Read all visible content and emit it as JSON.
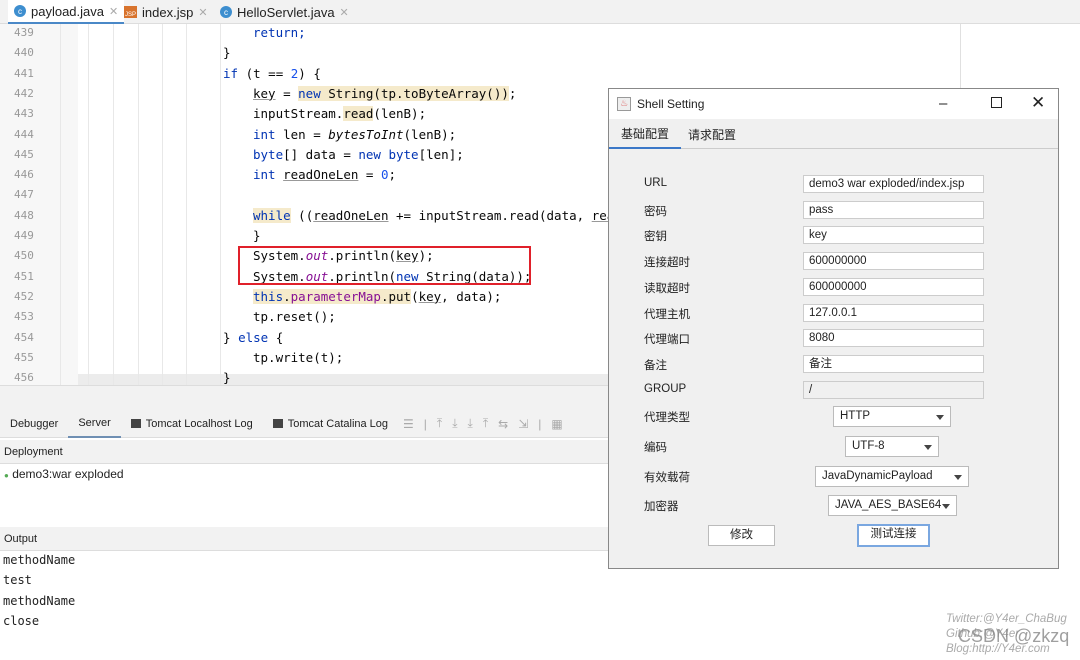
{
  "file_tabs": [
    {
      "label": "payload.java",
      "icon": "java-class-icon",
      "active": true
    },
    {
      "label": "index.jsp",
      "icon": "jsp-file-icon",
      "active": false
    },
    {
      "label": "HelloServlet.java",
      "icon": "java-class-icon",
      "active": false
    }
  ],
  "editor": {
    "line_numbers": [
      "439",
      "440",
      "441",
      "442",
      "443",
      "444",
      "445",
      "446",
      "447",
      "448",
      "449",
      "450",
      "451",
      "452",
      "453",
      "454",
      "455",
      "456"
    ],
    "lines": [
      {
        "indent": 2,
        "tokens": [
          [
            "return;",
            "kw"
          ]
        ]
      },
      {
        "indent": 1,
        "tokens": [
          [
            "}",
            ""
          ]
        ]
      },
      {
        "indent": 1,
        "tokens": [
          [
            "if",
            "kw"
          ],
          [
            " (t == ",
            ""
          ],
          [
            "2",
            "num"
          ],
          [
            ") {",
            ""
          ]
        ]
      },
      {
        "indent": 2,
        "tokens": [
          [
            "key",
            "ul"
          ],
          [
            " = ",
            ""
          ],
          [
            "new",
            "kw hl"
          ],
          [
            " String(tp.toByteArray())",
            "hl"
          ],
          [
            ";",
            ""
          ]
        ]
      },
      {
        "indent": 2,
        "tokens": [
          [
            "inputStream.",
            ""
          ],
          [
            "read",
            "hl"
          ],
          [
            "(lenB);",
            ""
          ]
        ]
      },
      {
        "indent": 2,
        "tokens": [
          [
            "int",
            "kw"
          ],
          [
            " len = ",
            ""
          ],
          [
            "bytesToInt",
            "it"
          ],
          [
            "(lenB);",
            ""
          ]
        ]
      },
      {
        "indent": 2,
        "tokens": [
          [
            "byte",
            "kw"
          ],
          [
            "[] data = ",
            ""
          ],
          [
            "new",
            "kw"
          ],
          [
            " ",
            ""
          ],
          [
            "byte",
            "kw"
          ],
          [
            "[len];",
            ""
          ]
        ]
      },
      {
        "indent": 2,
        "tokens": [
          [
            "int",
            "kw"
          ],
          [
            " ",
            ""
          ],
          [
            "readOneLen",
            "ul"
          ],
          [
            " = ",
            ""
          ],
          [
            "0",
            "num"
          ],
          [
            ";",
            ""
          ]
        ]
      },
      {
        "indent": 2,
        "tokens": []
      },
      {
        "indent": 2,
        "tokens": [
          [
            "while",
            "kw hl"
          ],
          [
            " ((",
            ""
          ],
          [
            "readOneLen",
            "ul"
          ],
          [
            " += inputStream.read(data, ",
            ""
          ],
          [
            "rea",
            "ul"
          ]
        ]
      },
      {
        "indent": 2,
        "tokens": [
          [
            "}",
            ""
          ]
        ]
      },
      {
        "indent": 2,
        "tokens": [
          [
            "System.",
            ""
          ],
          [
            "out",
            "fld"
          ],
          [
            ".println(",
            ""
          ],
          [
            "key",
            "ul"
          ],
          [
            ");",
            ""
          ]
        ]
      },
      {
        "indent": 2,
        "tokens": [
          [
            "System.",
            ""
          ],
          [
            "out",
            "fld"
          ],
          [
            ".println(",
            ""
          ],
          [
            "new",
            "kw"
          ],
          [
            " String(data));",
            ""
          ]
        ]
      },
      {
        "indent": 2,
        "tokens": [
          [
            "this",
            "kw hl"
          ],
          [
            ".",
            "hl"
          ],
          [
            "parameterMap",
            "mfld hl"
          ],
          [
            ".put",
            "hl"
          ],
          [
            "(",
            ""
          ],
          [
            "key",
            "ul"
          ],
          [
            ", data);",
            ""
          ]
        ]
      },
      {
        "indent": 2,
        "tokens": [
          [
            "tp.reset();",
            ""
          ]
        ]
      },
      {
        "indent": 1,
        "tokens": [
          [
            "} ",
            ""
          ],
          [
            "else",
            "kw"
          ],
          [
            " {",
            ""
          ]
        ]
      },
      {
        "indent": 2,
        "tokens": [
          [
            "tp.write(t);",
            ""
          ]
        ]
      },
      {
        "indent": 1,
        "tokens": [
          [
            "}",
            ""
          ]
        ]
      }
    ]
  },
  "bottom_tabs": [
    {
      "label": "Debugger"
    },
    {
      "label": "Server",
      "active": true
    },
    {
      "label": "Tomcat Localhost Log",
      "icon": "log-icon"
    },
    {
      "label": "Tomcat Catalina Log",
      "icon": "log-icon"
    }
  ],
  "deployment": {
    "header": "Deployment",
    "items": [
      "demo3:war exploded"
    ]
  },
  "output": {
    "header": "Output",
    "lines": [
      "methodName",
      "test",
      "methodName",
      "close"
    ]
  },
  "dialog": {
    "title": "Shell Setting",
    "tabs": [
      "基础配置",
      "请求配置"
    ],
    "fields": [
      {
        "label": "URL",
        "value": "demo3 war exploded/index.jsp"
      },
      {
        "label": "密码",
        "value": "pass"
      },
      {
        "label": "密钥",
        "value": "key"
      },
      {
        "label": "连接超时",
        "value": "600000000"
      },
      {
        "label": "读取超时",
        "value": "600000000"
      },
      {
        "label": "代理主机",
        "value": "127.0.0.1"
      },
      {
        "label": "代理端口",
        "value": "8080"
      },
      {
        "label": "备注",
        "value": "备注"
      },
      {
        "label": "GROUP",
        "value": "/",
        "disabled": true
      }
    ],
    "selects": [
      {
        "label": "代理类型",
        "value": "HTTP"
      },
      {
        "label": "编码",
        "value": "UTF-8"
      },
      {
        "label": "有效载荷",
        "value": "JavaDynamicPayload"
      },
      {
        "label": "加密器",
        "value": "JAVA_AES_BASE64"
      }
    ],
    "buttons": {
      "modify": "修改",
      "test": "测试连接"
    }
  },
  "watermark": {
    "lines": [
      "Twitter:@Y4er_ChaBug",
      "Github:@Y4er",
      "Blog:http://Y4er.com"
    ],
    "csdn": "CSDN @zkzq"
  },
  "colors": {
    "highlight_box": "#e0202a",
    "accent": "#3b78c8"
  }
}
